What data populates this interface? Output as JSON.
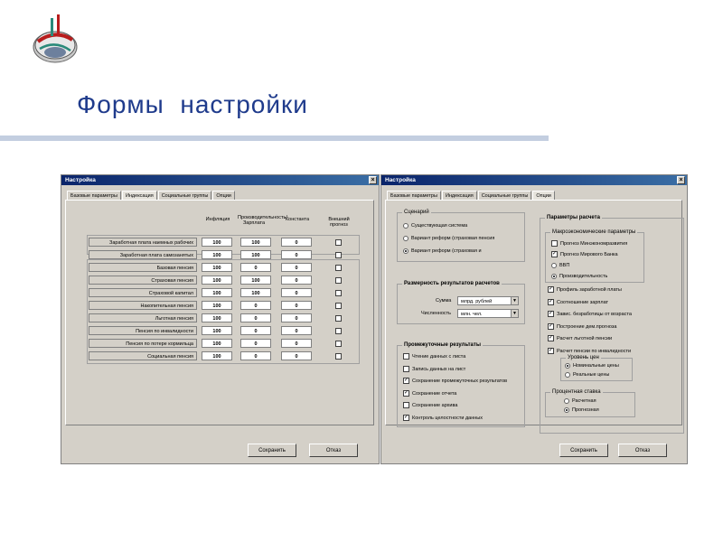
{
  "slide": {
    "title": "Формы  настройки"
  },
  "colors": {
    "title_blue": "#1f3b8c",
    "titlebar": "#0a246a",
    "dialog_bg": "#d4d0c8",
    "rule": "#c3cee0"
  },
  "dialog_left": {
    "title": "Настройка",
    "close": "×",
    "tabs": [
      "Базовые параметры",
      "Индексация",
      "Социальные группы",
      "Опции"
    ],
    "active_tab": "Индексация",
    "columns": [
      "Инфляция",
      "Производительность/Зарплата",
      "Константа",
      "Внешний прогноз"
    ],
    "rows_top": [
      {
        "label": "Заработная плата наемных рабочих",
        "v1": "100",
        "v2": "100",
        "v3": "0",
        "ext": false
      },
      {
        "label": "Заработная плата самозанятых",
        "v1": "100",
        "v2": "100",
        "v3": "0",
        "ext": false
      }
    ],
    "rows_bottom": [
      {
        "label": "Базовая пенсия",
        "v1": "100",
        "v2": "0",
        "v3": "0",
        "ext": false
      },
      {
        "label": "Страховая пенсия",
        "v1": "100",
        "v2": "100",
        "v3": "0",
        "ext": false
      },
      {
        "label": "Страховой капитал",
        "v1": "100",
        "v2": "100",
        "v3": "0",
        "ext": false
      },
      {
        "label": "Накопительная пенсия",
        "v1": "100",
        "v2": "0",
        "v3": "0",
        "ext": false
      },
      {
        "label": "Льготная пенсия",
        "v1": "100",
        "v2": "0",
        "v3": "0",
        "ext": false
      },
      {
        "label": "Пенсия по инвалидности",
        "v1": "100",
        "v2": "0",
        "v3": "0",
        "ext": false
      },
      {
        "label": "Пенсия по потере кормильца",
        "v1": "100",
        "v2": "0",
        "v3": "0",
        "ext": false
      },
      {
        "label": "Социальная пенсия",
        "v1": "100",
        "v2": "0",
        "v3": "0",
        "ext": false
      }
    ],
    "save": "Сохранить",
    "cancel": "Отказ"
  },
  "dialog_right": {
    "title": "Настройка",
    "close": "×",
    "tabs": [
      "Базовые параметры",
      "Индексация",
      "Социальные группы",
      "Опции"
    ],
    "active_tab": "Опции",
    "scenario": {
      "title": "Сценарий",
      "options": [
        "Существующая система",
        "Вариант реформ (страховая пенсия",
        "Вариант реформ (страховая и"
      ],
      "selected": 2
    },
    "dimension": {
      "title": "Размерность результатов расчетов",
      "sum_label": "Сумма",
      "sum_value": "млрд. рублей",
      "count_label": "Численность",
      "count_value": "млн. чел."
    },
    "intermediate": {
      "title": "Промежуточные результаты",
      "items": [
        {
          "label": "Чтение данных с листа",
          "checked": false
        },
        {
          "label": "Запись данных на лист",
          "checked": false
        },
        {
          "label": "Сохранение промежуточных результатов",
          "checked": true
        },
        {
          "label": "Сохранение отчета",
          "checked": true
        },
        {
          "label": "Сохранение архива",
          "checked": false
        },
        {
          "label": "Контроль целостности данных",
          "checked": true
        }
      ]
    },
    "calc": {
      "title": "Параметры расчета",
      "macro_title": "Макроэкономические параметры",
      "macro_items": [
        {
          "label": "Прогноз Минэкономразвития",
          "kind": "check",
          "checked": false
        },
        {
          "label": "Прогноз Мирового Банка",
          "kind": "check",
          "checked": true
        },
        {
          "label": "ВВП",
          "kind": "radio",
          "checked": false
        },
        {
          "label": "Производительность",
          "kind": "radio",
          "checked": true
        }
      ],
      "items": [
        {
          "label": "Профиль заработной платы",
          "checked": true
        },
        {
          "label": "Соотношение зарплат",
          "checked": true
        },
        {
          "label": "Завис. безработицы от возраста",
          "checked": true
        },
        {
          "label": "Построение дем.прогноза",
          "checked": true
        },
        {
          "label": "Расчет льготной пенсии",
          "checked": true
        },
        {
          "label": "Расчет пенсии по инвалидности",
          "checked": true
        }
      ],
      "price_title": "Уровень цен",
      "price_options": [
        "Номинальные цены",
        "Реальные цены"
      ],
      "price_selected": 0,
      "rate_title": "Процентная ставка",
      "rate_options": [
        "Расчетная",
        "Прогнозная"
      ],
      "rate_selected": 1
    },
    "save": "Сохранить",
    "cancel": "Отказ"
  }
}
